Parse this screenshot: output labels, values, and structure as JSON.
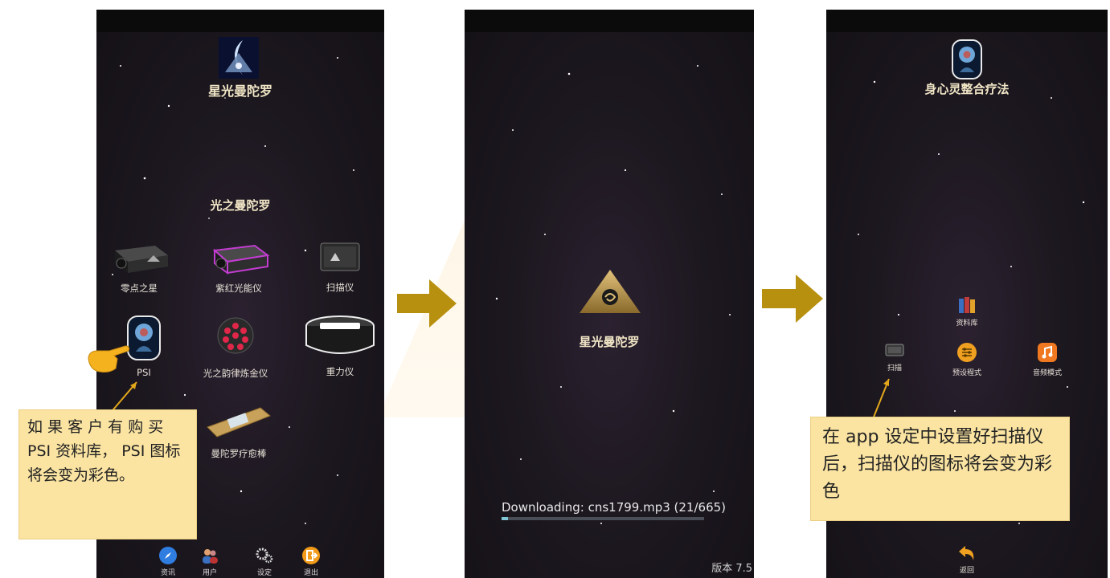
{
  "phone1": {
    "app_title": "星光曼陀罗",
    "section_title": "光之曼陀罗",
    "apps": [
      {
        "label": "零点之星"
      },
      {
        "label": "紫红光能仪"
      },
      {
        "label": "扫描仪"
      },
      {
        "label": "PSI"
      },
      {
        "label": "光之韵律炼金仪"
      },
      {
        "label": "重力仪"
      },
      {
        "label": "曼陀罗疗愈棒"
      }
    ],
    "nav": [
      {
        "label": "资讯",
        "icon": "compass-icon"
      },
      {
        "label": "用户",
        "icon": "users-icon"
      },
      {
        "label": "设定",
        "icon": "gear-icon"
      },
      {
        "label": "退出",
        "icon": "exit-icon"
      }
    ]
  },
  "phone2": {
    "app_title": "星光曼陀罗",
    "download_text": "Downloading: cns1799.mp3 (21/665)",
    "progress_fraction": 0.032,
    "version": "版本 7.5"
  },
  "phone3": {
    "app_title": "身心灵整合疗法",
    "items": [
      {
        "label": "资料库"
      },
      {
        "label": "扫描"
      },
      {
        "label": "预设程式"
      },
      {
        "label": "音频模式"
      }
    ],
    "back_label": "返回"
  },
  "notes": {
    "left": "如 果 客 户 有 购 买 PSI 资料库， PSI 图标将会变为彩色。",
    "right": "在 app 设定中设置好扫描仪后，扫描仪的图标将会变为彩色"
  },
  "colors": {
    "arrow": "#b8900f",
    "note_bg": "#fbe4a2",
    "title_gold": "#f1e6c6"
  }
}
